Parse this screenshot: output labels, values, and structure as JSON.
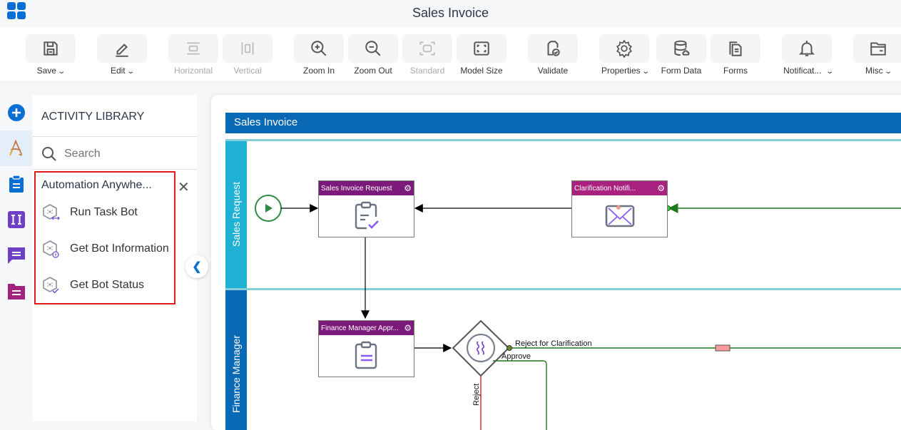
{
  "app": {
    "title": "Sales Invoice",
    "icon": "app-grid-icon"
  },
  "toolbar": {
    "buttons": [
      {
        "label": "Save",
        "icon": "save-icon",
        "dropdown": true,
        "disabled": false
      },
      {
        "label": "Edit",
        "icon": "pencil-icon",
        "dropdown": true,
        "disabled": false
      },
      {
        "label": "Horizontal",
        "icon": "horizontal-layout-icon",
        "dropdown": false,
        "disabled": true
      },
      {
        "label": "Vertical",
        "icon": "vertical-layout-icon",
        "dropdown": false,
        "disabled": true
      },
      {
        "label": "Zoom In",
        "icon": "zoom-in-icon",
        "dropdown": false,
        "disabled": false
      },
      {
        "label": "Zoom Out",
        "icon": "zoom-out-icon",
        "dropdown": false,
        "disabled": false
      },
      {
        "label": "Standard",
        "icon": "standard-size-icon",
        "dropdown": false,
        "disabled": true
      },
      {
        "label": "Model Size",
        "icon": "model-size-icon",
        "dropdown": false,
        "disabled": false
      },
      {
        "label": "Validate",
        "icon": "validate-icon",
        "dropdown": false,
        "disabled": false
      },
      {
        "label": "Properties",
        "icon": "gear-icon",
        "dropdown": true,
        "disabled": false
      },
      {
        "label": "Form Data",
        "icon": "database-icon",
        "dropdown": false,
        "disabled": false
      },
      {
        "label": "Forms",
        "icon": "forms-icon",
        "dropdown": false,
        "disabled": false
      },
      {
        "label": "Notificat...",
        "icon": "bell-icon",
        "dropdown": true,
        "disabled": false
      },
      {
        "label": "Misc",
        "icon": "folder-icon",
        "dropdown": true,
        "disabled": false
      }
    ]
  },
  "left_rail": {
    "items": [
      {
        "name": "add",
        "icon": "plus-circle-icon",
        "active": false
      },
      {
        "name": "activity-library",
        "icon": "activity-a-icon",
        "active": true
      },
      {
        "name": "forms",
        "icon": "clipboard-icon",
        "active": false
      },
      {
        "name": "variables",
        "icon": "text-field-icon",
        "active": false
      },
      {
        "name": "messages",
        "icon": "message-icon",
        "active": false
      },
      {
        "name": "documents",
        "icon": "folder-doc-icon",
        "active": false
      }
    ]
  },
  "library": {
    "title": "ACTIVITY LIBRARY",
    "search_placeholder": "Search",
    "group": {
      "title": "Automation Anywhe...",
      "items": [
        {
          "label": "Run Task Bot",
          "icon": "run-task-bot-icon"
        },
        {
          "label": "Get Bot Information",
          "icon": "get-bot-information-icon"
        },
        {
          "label": "Get Bot Status",
          "icon": "get-bot-status-icon"
        }
      ]
    }
  },
  "diagram": {
    "pool_title": "Sales Invoice",
    "lanes": [
      "Sales Request",
      "Finance Manager"
    ],
    "tasks": [
      {
        "id": "sales-invoice-request",
        "label": "Sales Invoice Request",
        "icon": "clipboard-check-icon"
      },
      {
        "id": "clarification-notification",
        "label": "Clarification Notifi...",
        "icon": "envelope-icon"
      },
      {
        "id": "finance-manager-approval",
        "label": "Finance Manager Appr...",
        "icon": "clipboard-list-icon"
      }
    ],
    "gateway_icon": "gateway-waves-icon",
    "flow_labels": {
      "reject_for_clarification": "Reject for Clarification",
      "approve": "Approve",
      "reject": "Reject"
    },
    "colors": {
      "task_header": "#7c1a7c",
      "task_header_notify": "#aa2280",
      "pool_header": "#0a69b4",
      "lane_sales": "#1eb1d3",
      "lane_finance": "#0a69b4",
      "flow_green": "#1a7a1a",
      "flow_red": "#d42020"
    }
  }
}
